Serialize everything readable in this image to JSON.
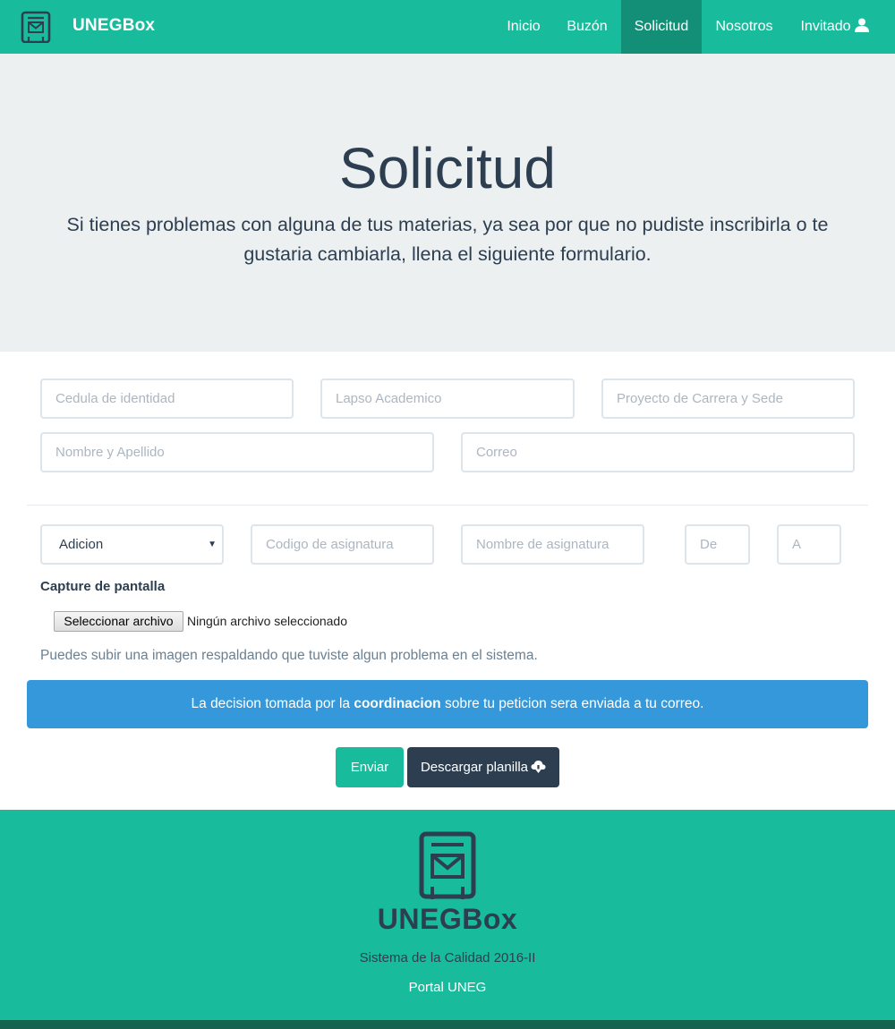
{
  "nav": {
    "brand": "UNEGBox",
    "items": [
      {
        "label": "Inicio",
        "active": false
      },
      {
        "label": "Buzón",
        "active": false
      },
      {
        "label": "Solicitud",
        "active": true
      },
      {
        "label": "Nosotros",
        "active": false
      },
      {
        "label": "Invitado",
        "active": false
      }
    ],
    "user_icon": "user-icon"
  },
  "hero": {
    "title": "Solicitud",
    "text": "Si tienes problemas con alguna de tus materias, ya sea por que no pudiste inscribirla o te gustaria cambiarla, llena el siguiente formulario."
  },
  "form": {
    "cedula": {
      "placeholder": "Cedula de identidad",
      "value": ""
    },
    "lapso": {
      "placeholder": "Lapso Academico",
      "value": ""
    },
    "proyecto": {
      "placeholder": "Proyecto de Carrera y Sede",
      "value": ""
    },
    "nombre": {
      "placeholder": "Nombre y Apellido",
      "value": ""
    },
    "correo": {
      "placeholder": "Correo",
      "value": ""
    },
    "tipo": {
      "selected": "Adicion"
    },
    "codigo": {
      "placeholder": "Codigo de asignatura",
      "value": ""
    },
    "asignatura": {
      "placeholder": "Nombre de asignatura",
      "value": ""
    },
    "de": {
      "placeholder": "De",
      "value": ""
    },
    "a": {
      "placeholder": "A",
      "value": ""
    },
    "capture_label": "Capture de pantalla",
    "file_button": "Seleccionar archivo",
    "file_status": "Ningún archivo seleccionado",
    "help": "Puedes subir una imagen respaldando que tuviste algun problema en el sistema."
  },
  "alert": {
    "before": "La decision tomada por la ",
    "strong": "coordinacion",
    "after": " sobre tu peticion sera enviada a tu correo."
  },
  "buttons": {
    "send": "Enviar",
    "download": "Descargar planilla",
    "download_icon": "cloud-download-icon"
  },
  "footer": {
    "brand": "UNEGBox",
    "subtitle": "Sistema de la Calidad 2016-II",
    "link": "Portal UNEG"
  },
  "colors": {
    "primary": "#18bc9c",
    "dark": "#2c3e50",
    "info": "#3498db",
    "light": "#ecf0f1"
  }
}
